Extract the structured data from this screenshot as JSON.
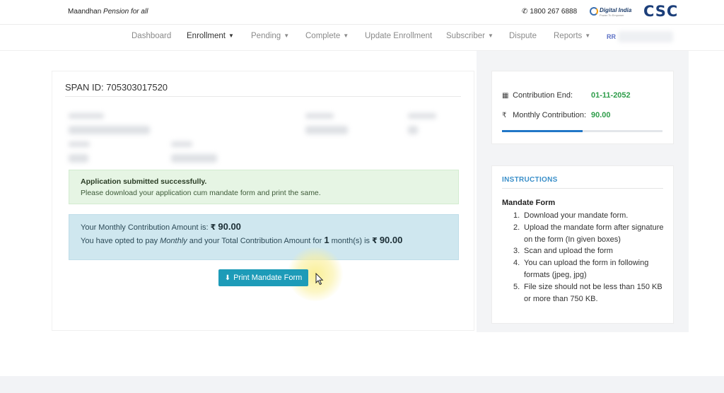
{
  "header": {
    "brand_name": "Maandhan",
    "brand_tagline": "Pension for all",
    "phone": "1800 267 6888",
    "digital_india_text": "Digital India",
    "digital_india_sub": "Power To Empower",
    "csc_logo": "CSC"
  },
  "nav": {
    "items": [
      {
        "label": "Dashboard",
        "dropdown": false
      },
      {
        "label": "Enrollment",
        "dropdown": true,
        "active": true
      },
      {
        "label": "Pending",
        "dropdown": true
      },
      {
        "label": "Complete",
        "dropdown": true
      },
      {
        "label": "Update Enrollment",
        "dropdown": false
      },
      {
        "label": "Subscriber",
        "dropdown": true
      },
      {
        "label": "Dispute",
        "dropdown": false
      },
      {
        "label": "Reports",
        "dropdown": true
      }
    ],
    "caret": "▼",
    "user_initials": "RR"
  },
  "main": {
    "span_id": "SPAN ID: 705303017520",
    "success_title": "Application submitted successfully.",
    "success_text": "Please download your application cum mandate form and print the same.",
    "info_line1_prefix": "Your Monthly Contribution Amount is:",
    "rupee_symbol": "₹",
    "monthly_amount": "90.00",
    "info_line2_a": "You have opted to pay",
    "info_line2_mode": "Monthly",
    "info_line2_b": "and your Total Contribution Amount for",
    "info_line2_months": "1",
    "info_line2_c": "month(s) is",
    "total_amount": "90.00",
    "print_button": "Print Mandate Form",
    "print_icon": "⬇"
  },
  "sidebar": {
    "contribution_end_label": "Contribution End:",
    "contribution_end_value": "01-11-2052",
    "monthly_contribution_label": "Monthly Contribution:",
    "monthly_contribution_value": "90.00",
    "rupee_symbol": "₹",
    "calendar_icon": "calendar-icon",
    "progress_fraction": 0.5,
    "instructions_title": "INSTRUCTIONS",
    "mandate_heading": "Mandate Form",
    "steps": [
      {
        "num": "1.",
        "text": "Download your mandate form."
      },
      {
        "num": "2.",
        "text": "Upload the mandate form after signature on the form (In given boxes)"
      },
      {
        "num": "3.",
        "text": "Scan and upload the form"
      },
      {
        "num": "4.",
        "text": "You can upload the form in following formats (jpeg, jpg)"
      },
      {
        "num": "5.",
        "text": "File size should not be less than 150 KB or more than 750 KB."
      }
    ]
  },
  "colors": {
    "accent": "#1d9bb8",
    "success_bg": "#e6f5e4",
    "info_bg": "#cfe7ef",
    "green_value": "#2e9d4a",
    "progress": "#2176c7",
    "instructions_title": "#3a8fc9"
  }
}
